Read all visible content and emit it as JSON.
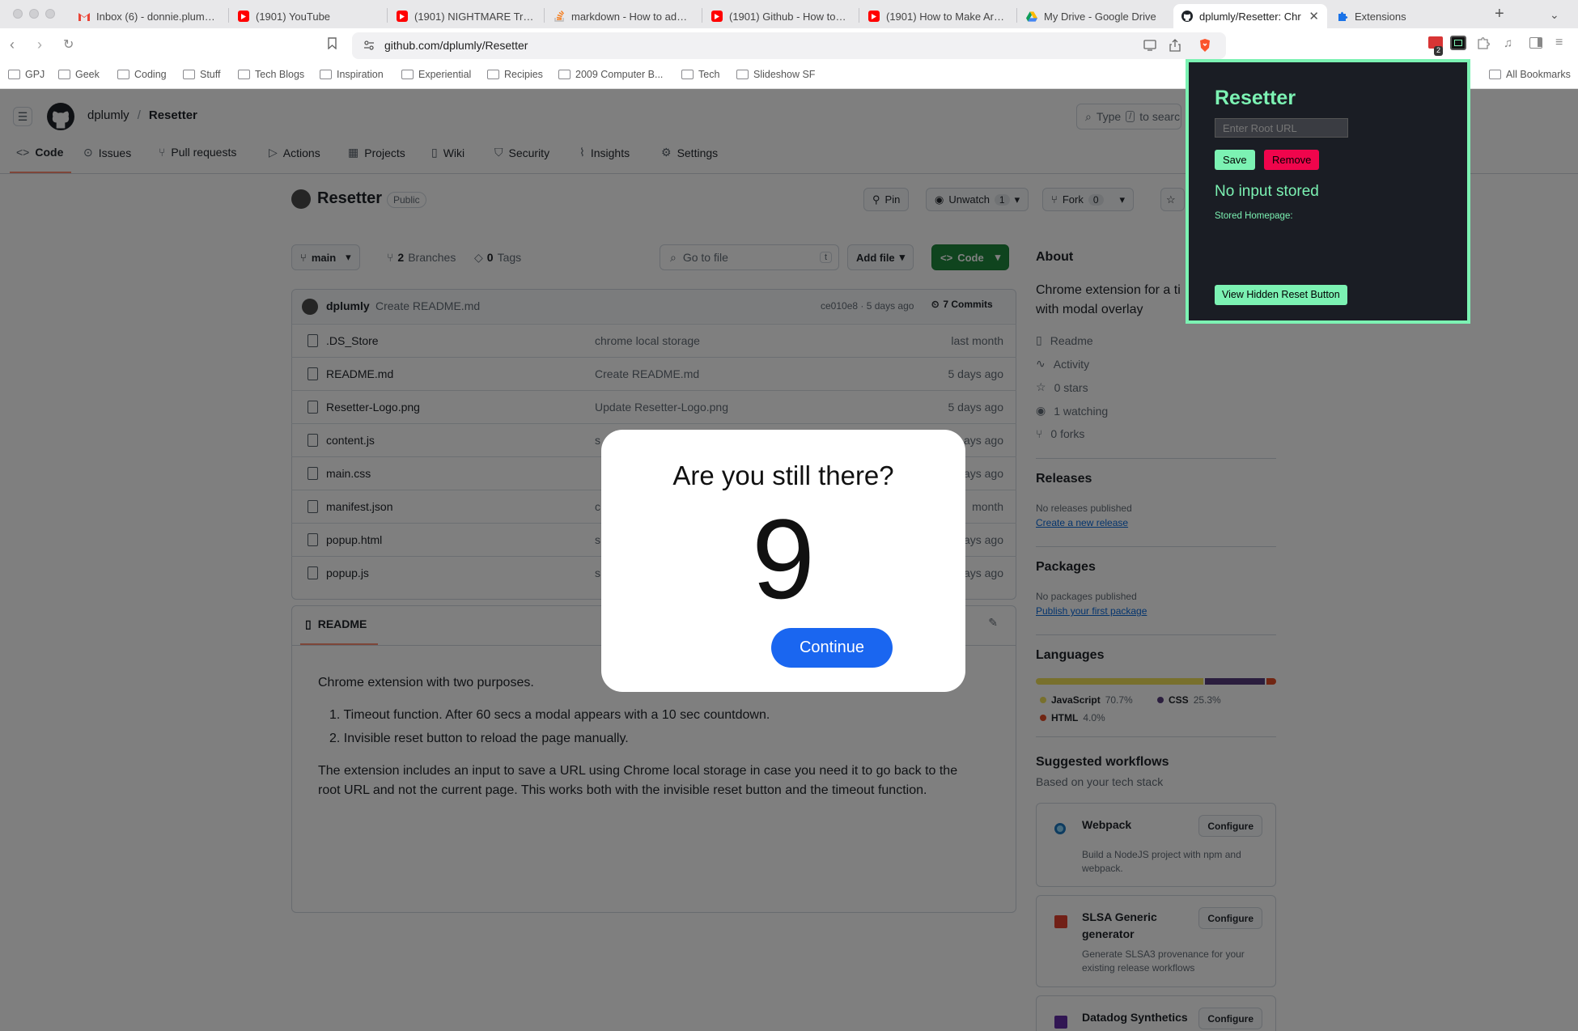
{
  "browser": {
    "tabs": [
      {
        "title": "Inbox (6) - donnie.plumly@",
        "icon": "gmail-icon",
        "active": false
      },
      {
        "title": "(1901) YouTube",
        "icon": "youtube-icon",
        "active": false
      },
      {
        "title": "(1901) NIGHTMARE Trump",
        "icon": "youtube-icon",
        "active": false
      },
      {
        "title": "markdown - How to add im",
        "icon": "stackoverflow-icon",
        "active": false
      },
      {
        "title": "(1901) Github - How to up",
        "icon": "youtube-icon",
        "active": false
      },
      {
        "title": "(1901) How to Make Ardui",
        "icon": "youtube-icon",
        "active": false
      },
      {
        "title": "My Drive - Google Drive",
        "icon": "google-drive-icon",
        "active": false
      },
      {
        "title": "dplumly/Resetter: Chr",
        "icon": "github-icon",
        "active": true
      },
      {
        "title": "Extensions",
        "icon": "puzzle-icon",
        "active": false
      }
    ],
    "url": "github.com/dplumly/Resetter",
    "extension_badge": "2",
    "bookmarks": [
      "GPJ",
      "Geek",
      "Coding",
      "Stuff",
      "Tech Blogs",
      "Inspiration",
      "Experiential",
      "Recipies",
      "2009 Computer B...",
      "Tech",
      "Slideshow SF"
    ],
    "all_bookmarks": "All Bookmarks"
  },
  "github": {
    "owner": "dplumly",
    "separator": "/",
    "repo": "Resetter",
    "search_placeholder_start": "Type",
    "search_key": "/",
    "search_placeholder_end": "to search",
    "nav": [
      "Code",
      "Issues",
      "Pull requests",
      "Actions",
      "Projects",
      "Wiki",
      "Security",
      "Insights",
      "Settings"
    ],
    "repo_title": "Resetter",
    "visibility": "Public",
    "pin_label": "Pin",
    "unwatch_label": "Unwatch",
    "unwatch_count": "1",
    "fork_label": "Fork",
    "fork_count": "0",
    "branch": "main",
    "branches_count": "2",
    "branches_label": "Branches",
    "tags_count": "0",
    "tags_label": "Tags",
    "goto_placeholder": "Go to file",
    "goto_key": "t",
    "add_file": "Add file",
    "code_button": "Code",
    "commit": {
      "author": "dplumly",
      "message": "Create README.md",
      "hash_time": "ce010e8 · 5 days ago",
      "commits_label": "7 Commits"
    },
    "files": [
      {
        "name": ".DS_Store",
        "message": "chrome local storage",
        "date": "last month"
      },
      {
        "name": "README.md",
        "message": "Create README.md",
        "date": "5 days ago"
      },
      {
        "name": "Resetter-Logo.png",
        "message": "Update Resetter-Logo.png",
        "date": "5 days ago"
      },
      {
        "name": "content.js",
        "message": "s",
        "date": "ays ago"
      },
      {
        "name": "main.css",
        "message": "",
        "date": "ays ago"
      },
      {
        "name": "manifest.json",
        "message": "c",
        "date": "month"
      },
      {
        "name": "popup.html",
        "message": "s",
        "date": "ays ago"
      },
      {
        "name": "popup.js",
        "message": "s",
        "date": "ays ago"
      }
    ],
    "readme": {
      "tab": "README",
      "intro": "Chrome extension with two purposes.",
      "list": [
        "Timeout function. After 60 secs a modal appears with a 10 sec countdown.",
        "Invisible reset button to reload the page manually."
      ],
      "para1": "The extension includes an input to save a URL using Chrome local storage in case you need it to go back to the",
      "para2": "root URL and not the current page. This works both with the invisible reset button and the timeout function."
    },
    "about": {
      "heading": "About",
      "desc1": "Chrome extension for a ti",
      "desc2": "with modal overlay",
      "items": [
        {
          "icon": "book-icon",
          "label": "Readme"
        },
        {
          "icon": "pulse-icon",
          "label": "Activity"
        },
        {
          "icon": "star-icon",
          "label": "0 stars"
        },
        {
          "icon": "eye-icon",
          "label": "1 watching"
        },
        {
          "icon": "fork-icon",
          "label": "0 forks"
        }
      ]
    },
    "releases": {
      "heading": "Releases",
      "none": "No releases published",
      "link": "Create a new release"
    },
    "packages": {
      "heading": "Packages",
      "none": "No packages published",
      "link": "Publish your first package"
    },
    "languages": {
      "heading": "Languages",
      "items": [
        {
          "name": "JavaScript",
          "pct": "70.7%",
          "value": 70.7,
          "color": "#f1e05a"
        },
        {
          "name": "CSS",
          "pct": "25.3%",
          "value": 25.3,
          "color": "#563d7c"
        },
        {
          "name": "HTML",
          "pct": "4.0%",
          "value": 4.0,
          "color": "#e34c26"
        }
      ]
    },
    "workflows": {
      "heading": "Suggested workflows",
      "sub": "Based on your tech stack",
      "items": [
        {
          "name": "Webpack",
          "desc1": "Build a NodeJS project with npm and",
          "desc2": "webpack.",
          "button": "Configure"
        },
        {
          "name": "SLSA Generic",
          "name2": "generator",
          "desc1": "Generate SLSA3 provenance for your",
          "desc2": "existing release workflows",
          "button": "Configure"
        },
        {
          "name": "Datadog Synthetics",
          "button": "Configure"
        }
      ]
    }
  },
  "modal": {
    "title": "Are you still there?",
    "countdown": "9",
    "button": "Continue"
  },
  "extension_popup": {
    "title": "Resetter",
    "input_placeholder": "Enter Root URL",
    "save": "Save",
    "remove": "Remove",
    "status": "No input stored",
    "stored_label": "Stored Homepage:",
    "view_button": "View Hidden Reset Button",
    "accent": "#7cf2b3",
    "danger": "#f0054c"
  }
}
